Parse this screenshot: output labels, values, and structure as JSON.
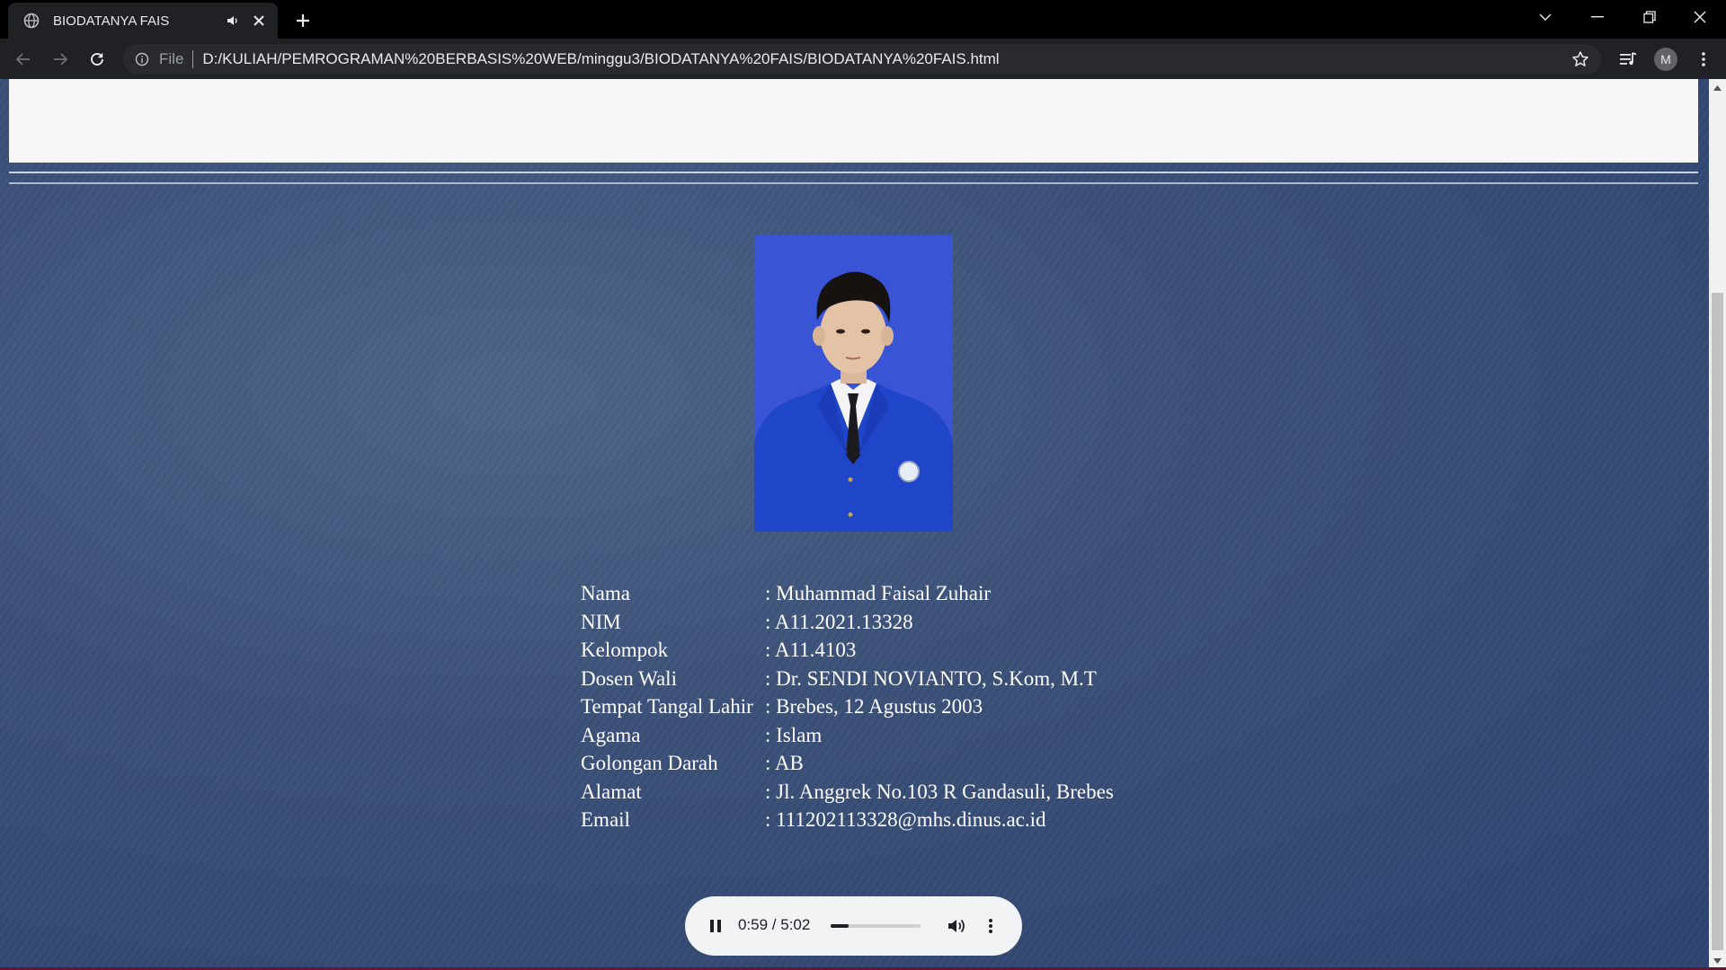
{
  "browser": {
    "tab_title": "BIODATANYA FAIS",
    "omnibox_scheme": "File",
    "url": "D:/KULIAH/PEMROGRAMAN%20BERBASIS%20WEB/minggu3/BIODATANYA%20FAIS/BIODATANYA%20FAIS.html",
    "profile_initial": "M"
  },
  "biodata": [
    {
      "label": "Nama",
      "value": ": Muhammad Faisal Zuhair"
    },
    {
      "label": "NIM",
      "value": ": A11.2021.13328"
    },
    {
      "label": "Kelompok",
      "value": ": A11.4103"
    },
    {
      "label": "Dosen Wali",
      "value": ": Dr. SENDI NOVIANTO, S.Kom, M.T"
    },
    {
      "label": "Tempat Tangal Lahir",
      "value": ": Brebes, 12 Agustus 2003"
    },
    {
      "label": "Agama",
      "value": ": Islam"
    },
    {
      "label": "Golongan Darah",
      "value": ": AB"
    },
    {
      "label": "Alamat",
      "value": ": Jl. Anggrek No.103 R Gandasuli, Brebes"
    },
    {
      "label": "Email",
      "value": ": 111202113328@mhs.dinus.ac.id"
    }
  ],
  "audio": {
    "time": "0:59 / 5:02",
    "progress_fraction": 0.195,
    "state": "playing"
  },
  "icons": {
    "tab_favicon": "globe-icon",
    "tab_audio": "speaker-icon",
    "tab_close": "close-icon",
    "new_tab": "plus-icon",
    "back": "arrow-left-icon",
    "forward": "arrow-right-icon",
    "reload": "reload-icon",
    "info": "info-icon",
    "bookmark": "star-icon",
    "media": "media-queue-icon",
    "menu": "kebab-icon"
  },
  "colors": {
    "page_bg": "#3c5178",
    "photo_bg": "#3a54d6",
    "jacket": "#1f45c8"
  }
}
